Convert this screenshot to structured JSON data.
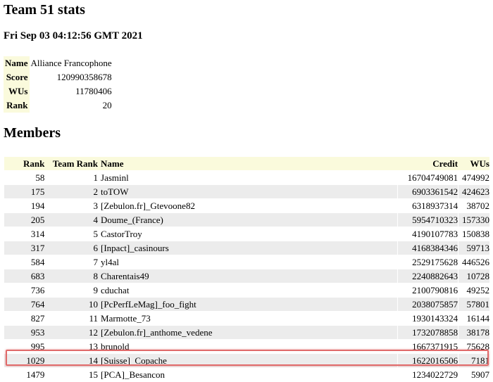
{
  "page": {
    "title": "Team 51 stats",
    "timestamp": "Fri Sep 03 04:12:56 GMT 2021",
    "members_heading": "Members"
  },
  "summary": [
    {
      "label": "Name",
      "value": "Alliance Francophone"
    },
    {
      "label": "Score",
      "value": "120990358678"
    },
    {
      "label": "WUs",
      "value": "11780406"
    },
    {
      "label": "Rank",
      "value": "20"
    }
  ],
  "members": {
    "headers": {
      "rank": "Rank",
      "team_rank": "Team Rank",
      "name": "Name",
      "credit": "Credit",
      "wus": "WUs"
    },
    "highlighted_row": 13,
    "highlight_color": "#e06a6a",
    "header_bg": "#fafadc",
    "stripe_bg": "#ececec",
    "rows": [
      {
        "rank": "58",
        "team_rank": "1",
        "name": "Jasminl",
        "credit": "16704749081",
        "wus": "474992"
      },
      {
        "rank": "175",
        "team_rank": "2",
        "name": "toTOW",
        "credit": "6903361542",
        "wus": "424623"
      },
      {
        "rank": "194",
        "team_rank": "3",
        "name": "[Zebulon.fr]_Gtevoone82",
        "credit": "6318937314",
        "wus": "38702"
      },
      {
        "rank": "205",
        "team_rank": "4",
        "name": "Doume_(France)",
        "credit": "5954710323",
        "wus": "157330"
      },
      {
        "rank": "314",
        "team_rank": "5",
        "name": "CastorTroy",
        "credit": "4190107783",
        "wus": "150838"
      },
      {
        "rank": "317",
        "team_rank": "6",
        "name": "[Inpact]_casinours",
        "credit": "4168384346",
        "wus": "59713"
      },
      {
        "rank": "584",
        "team_rank": "7",
        "name": "yl4al",
        "credit": "2529175628",
        "wus": "446526"
      },
      {
        "rank": "683",
        "team_rank": "8",
        "name": "Charentais49",
        "credit": "2240882643",
        "wus": "10728"
      },
      {
        "rank": "736",
        "team_rank": "9",
        "name": "cduchat",
        "credit": "2100790816",
        "wus": "49252"
      },
      {
        "rank": "764",
        "team_rank": "10",
        "name": "[PcPerfLeMag]_foo_fight",
        "credit": "2038075857",
        "wus": "57801"
      },
      {
        "rank": "827",
        "team_rank": "11",
        "name": "Marmotte_73",
        "credit": "1930143324",
        "wus": "16144"
      },
      {
        "rank": "953",
        "team_rank": "12",
        "name": "[Zebulon.fr]_anthome_vedene",
        "credit": "1732078858",
        "wus": "38178"
      },
      {
        "rank": "995",
        "team_rank": "13",
        "name": "brunold",
        "credit": "1667371915",
        "wus": "75628"
      },
      {
        "rank": "1029",
        "team_rank": "14",
        "name": "[Suisse]_Copache",
        "credit": "1622016506",
        "wus": "7181"
      },
      {
        "rank": "1479",
        "team_rank": "15",
        "name": "[PCA]_Besancon",
        "credit": "1234022729",
        "wus": "5907"
      }
    ]
  }
}
